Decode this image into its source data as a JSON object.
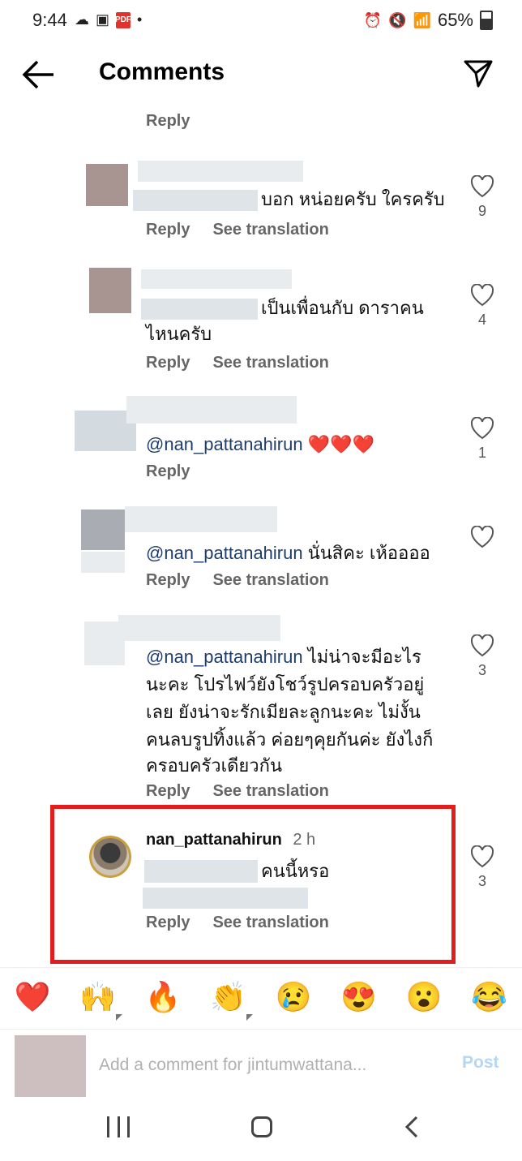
{
  "status_bar": {
    "time": "9:44",
    "battery": "65%",
    "pdf_badge": "PDF"
  },
  "header": {
    "title": "Comments"
  },
  "top_reply": "Reply",
  "comments": [
    {
      "text": "บอก หน่อยครับ ใครครับ",
      "reply": "Reply",
      "translate": "See translation",
      "likes": "9"
    },
    {
      "text_line1": "เป็นเพื่อนกับ ดาราคน",
      "text_line2": "ไหนครับ",
      "reply": "Reply",
      "translate": "See translation",
      "likes": "4"
    },
    {
      "mention": "@nan_pattanahirun",
      "text": " ❤️❤️❤️",
      "reply": "Reply",
      "likes": "1"
    },
    {
      "mention": "@nan_pattanahirun",
      "text": " นั่นสิคะ เห้ออออ",
      "reply": "Reply",
      "translate": "See translation"
    },
    {
      "mention": "@nan_pattanahirun",
      "line1": " ไม่น่าจะมีอะไร",
      "line2": "นะคะ โปรไฟว์ยังโชว์รูปครอบครัวอยู่",
      "line3": "เลย ยังน่าจะรักเมียละลูกนะคะ ไม่งั้น",
      "line4": "คนลบรูปทิ้งแล้ว ค่อยๆคุยกันค่ะ ยังไงก็",
      "line5": "ครอบครัวเดียวกัน",
      "reply": "Reply",
      "translate": "See translation",
      "likes": "3"
    },
    {
      "username": "nan_pattanahirun",
      "time": "2 h",
      "text": "คนนี้หรอ",
      "reply": "Reply",
      "translate": "See translation",
      "likes": "3"
    }
  ],
  "emoji_bar": [
    "❤️",
    "🙌",
    "🔥",
    "👏",
    "😢",
    "😍",
    "😮",
    "😂"
  ],
  "composer": {
    "placeholder": "Add a comment for jintumwattana...",
    "post_label": "Post"
  },
  "colors": {
    "highlight": "#e11d1d",
    "mention": "#1f3d6b",
    "post_disabled": "#b3d7f5"
  }
}
